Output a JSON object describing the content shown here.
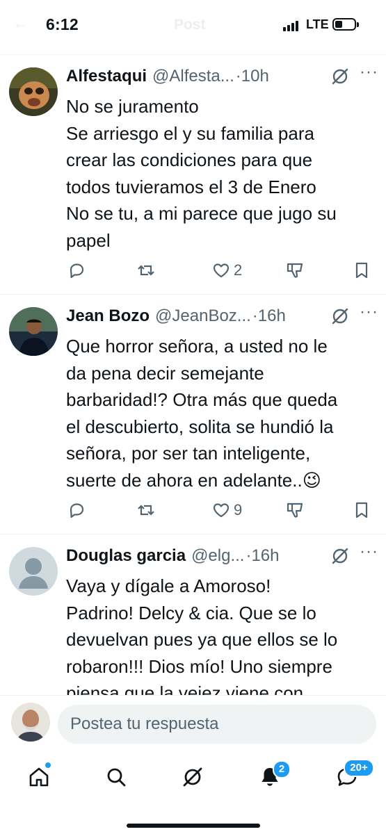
{
  "status_bar": {
    "time": "6:12",
    "network": "LTE",
    "ghost_title": "Post"
  },
  "posts": [
    {
      "name": "Alfestaqui",
      "handle": "@Alfesta...",
      "time": "·10h",
      "lines": [
        "No se juramento",
        "Se arriesgo el y su familia para",
        "crear las condiciones para que",
        "todos tuvieramos el 3 de Enero",
        "No se tu, a mi parece que jugo su",
        "papel"
      ],
      "likes": "2"
    },
    {
      "name": "Jean Bozo",
      "handle": "@JeanBoz...",
      "time": "·16h",
      "lines": [
        "Que horror señora, a usted no le",
        "da pena decir semejante",
        "barbaridad!? Otra más que queda",
        "el descubierto, solita se hundió la",
        "señora, por ser tan inteligente,",
        "suerte de ahora en adelante..😉"
      ],
      "likes": "9"
    },
    {
      "name": "Douglas garcia",
      "handle": "@elg...",
      "time": "·16h",
      "lines": [
        "Vaya y dígale a Amoroso!",
        "Padrino! Delcy & cia. Que se lo",
        "devuelvan pues ya que ellos se lo",
        "robaron!!! Dios mío! Uno siempre",
        "piensa que la vejez viene con"
      ]
    }
  ],
  "reply": {
    "placeholder": "Postea tu respuesta"
  },
  "tabs": {
    "notifications_badge": "2",
    "messages_badge": "20+"
  },
  "colors": {
    "accent": "#1d9bf0",
    "muted": "#536471",
    "text": "#0f1419"
  }
}
